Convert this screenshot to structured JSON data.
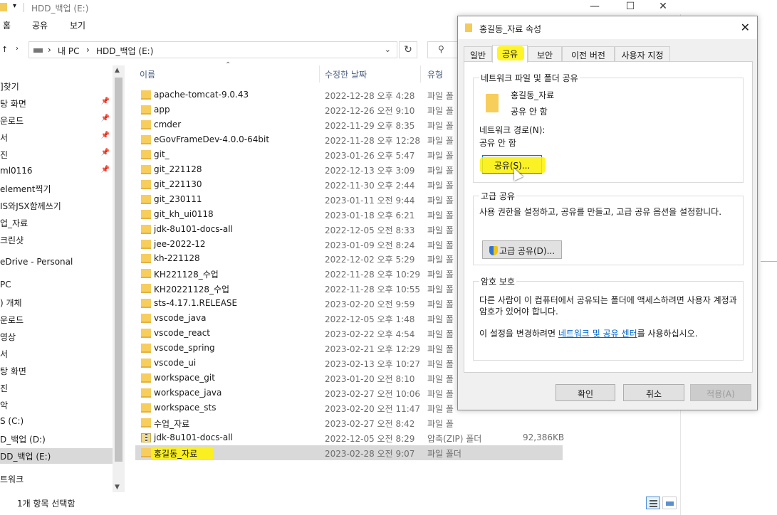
{
  "explorer": {
    "window_title": "HDD_백업 (E:)",
    "ribbon": [
      "홈",
      "공유",
      "보기"
    ],
    "breadcrumb": [
      "내 PC",
      "HDD_백업 (E:)"
    ],
    "columns": {
      "name": "이름",
      "date": "수정한 날짜",
      "type": "유형"
    },
    "nav_items": [
      {
        "label": "]찾기",
        "pin": false
      },
      {
        "label": "탕 화면",
        "pin": true
      },
      {
        "label": "운로드",
        "pin": true
      },
      {
        "label": "서",
        "pin": true
      },
      {
        "label": "진",
        "pin": true
      },
      {
        "label": "ml0116",
        "pin": true
      },
      {
        "label": "element찍기",
        "pin": false
      },
      {
        "label": "IS와JSX함께쓰기",
        "pin": false
      },
      {
        "label": "업_자료",
        "pin": false
      },
      {
        "label": "크린샷",
        "pin": false
      },
      {
        "label": "eDrive - Personal",
        "pin": false
      },
      {
        "label": "PC",
        "pin": false
      },
      {
        "label": ") 개체",
        "pin": false
      },
      {
        "label": "운로드",
        "pin": false
      },
      {
        "label": "영상",
        "pin": false
      },
      {
        "label": "서",
        "pin": false
      },
      {
        "label": "탕 화면",
        "pin": false
      },
      {
        "label": "진",
        "pin": false
      },
      {
        "label": "악",
        "pin": false
      },
      {
        "label": "S (C:)",
        "pin": false
      },
      {
        "label": "D_백업 (D:)",
        "pin": false
      },
      {
        "label": "DD_백업 (E:)",
        "pin": false,
        "selected": true
      },
      {
        "label": "트워크",
        "pin": false
      }
    ],
    "files": [
      {
        "name": "apache-tomcat-9.0.43",
        "date": "2022-12-28 오후 4:28",
        "type": "파일 폴",
        "size": ""
      },
      {
        "name": "app",
        "date": "2022-12-26 오전 9:10",
        "type": "파일 폴",
        "size": ""
      },
      {
        "name": "cmder",
        "date": "2022-11-29 오후 8:35",
        "type": "파일 폴",
        "size": ""
      },
      {
        "name": "eGovFrameDev-4.0.0-64bit",
        "date": "2022-11-28 오후 12:28",
        "type": "파일 폴",
        "size": ""
      },
      {
        "name": "git_",
        "date": "2023-01-26 오후 5:47",
        "type": "파일 폴",
        "size": ""
      },
      {
        "name": "git_221128",
        "date": "2022-12-13 오후 3:09",
        "type": "파일 폴",
        "size": ""
      },
      {
        "name": "git_221130",
        "date": "2022-11-30 오후 2:44",
        "type": "파일 폴",
        "size": ""
      },
      {
        "name": "git_230111",
        "date": "2023-01-11 오전 9:44",
        "type": "파일 폴",
        "size": ""
      },
      {
        "name": "git_kh_ui0118",
        "date": "2023-01-18 오후 6:21",
        "type": "파일 폴",
        "size": ""
      },
      {
        "name": "jdk-8u101-docs-all",
        "date": "2022-12-05 오전 8:33",
        "type": "파일 폴",
        "size": ""
      },
      {
        "name": "jee-2022-12",
        "date": "2023-01-09 오전 8:24",
        "type": "파일 폴",
        "size": ""
      },
      {
        "name": "kh-221128",
        "date": "2022-12-02 오후 5:29",
        "type": "파일 폴",
        "size": ""
      },
      {
        "name": "KH221128_수업",
        "date": "2022-11-28 오후 10:29",
        "type": "파일 폴",
        "size": ""
      },
      {
        "name": "KH20221128_수업",
        "date": "2022-11-28 오후 10:55",
        "type": "파일 폴",
        "size": ""
      },
      {
        "name": "sts-4.17.1.RELEASE",
        "date": "2023-02-20 오전 9:59",
        "type": "파일 폴",
        "size": ""
      },
      {
        "name": "vscode_java",
        "date": "2022-12-05 오후 1:48",
        "type": "파일 폴",
        "size": ""
      },
      {
        "name": "vscode_react",
        "date": "2023-02-22 오후 4:54",
        "type": "파일 폴",
        "size": ""
      },
      {
        "name": "vscode_spring",
        "date": "2023-02-21 오후 12:29",
        "type": "파일 폴",
        "size": ""
      },
      {
        "name": "vscode_ui",
        "date": "2023-02-13 오후 10:27",
        "type": "파일 폴",
        "size": ""
      },
      {
        "name": "workspace_git",
        "date": "2023-01-20 오전 8:10",
        "type": "파일 폴",
        "size": ""
      },
      {
        "name": "workspace_java",
        "date": "2023-02-27 오전 10:06",
        "type": "파일 폴",
        "size": ""
      },
      {
        "name": "workspace_sts",
        "date": "2023-02-20 오전 11:47",
        "type": "파일 폴",
        "size": ""
      },
      {
        "name": "수업_자료",
        "date": "2023-02-27 오전 8:42",
        "type": "파일 폴",
        "size": ""
      },
      {
        "name": "jdk-8u101-docs-all",
        "date": "2022-12-05 오전 8:29",
        "type": "압축(ZIP) 폴더",
        "size": "92,386KB",
        "zip": true
      },
      {
        "name": "홍길동_자료",
        "date": "2023-02-28 오전 9:07",
        "type": "파일 폴더",
        "size": "",
        "selected": true
      }
    ],
    "status": {
      "count": "",
      "selection": "1개 항목 선택함"
    }
  },
  "dialog": {
    "title": "홍길동_자료 속성",
    "tabs": [
      "일반",
      "공유",
      "보안",
      "이전 버전",
      "사용자 지정"
    ],
    "active_tab": "공유",
    "network_group_title": "네트워크 파일 및 폴더 공유",
    "folder_name": "홍길동_자료",
    "share_state": "공유 안 함",
    "network_path_label": "네트워크 경로(N):",
    "network_path_value": "공유 안 함",
    "share_button": "공유(S)...",
    "advanced_group_title": "고급 공유",
    "advanced_desc": "사용 권한을 설정하고, 공유를 만들고, 고급 공유 옵션을 설정합니다.",
    "advanced_button": "고급 공유(D)...",
    "password_group_title": "암호 보호",
    "password_desc": "다른 사람이 이 컴퓨터에서 공유되는 폴더에 액세스하려면 사용자 계정과 암호가 있어야 합니다.",
    "change_prefix": "이 설정을 변경하려면 ",
    "change_link": "네트워크 및 공유 센터",
    "change_suffix": "를 사용하십시오.",
    "ok": "확인",
    "cancel": "취소",
    "apply": "적용(A)"
  },
  "colors": {
    "highlight": "#fff200",
    "folder": "#f7cd5c",
    "link": "#0066cc",
    "selected_row": "#d9d9d9"
  }
}
